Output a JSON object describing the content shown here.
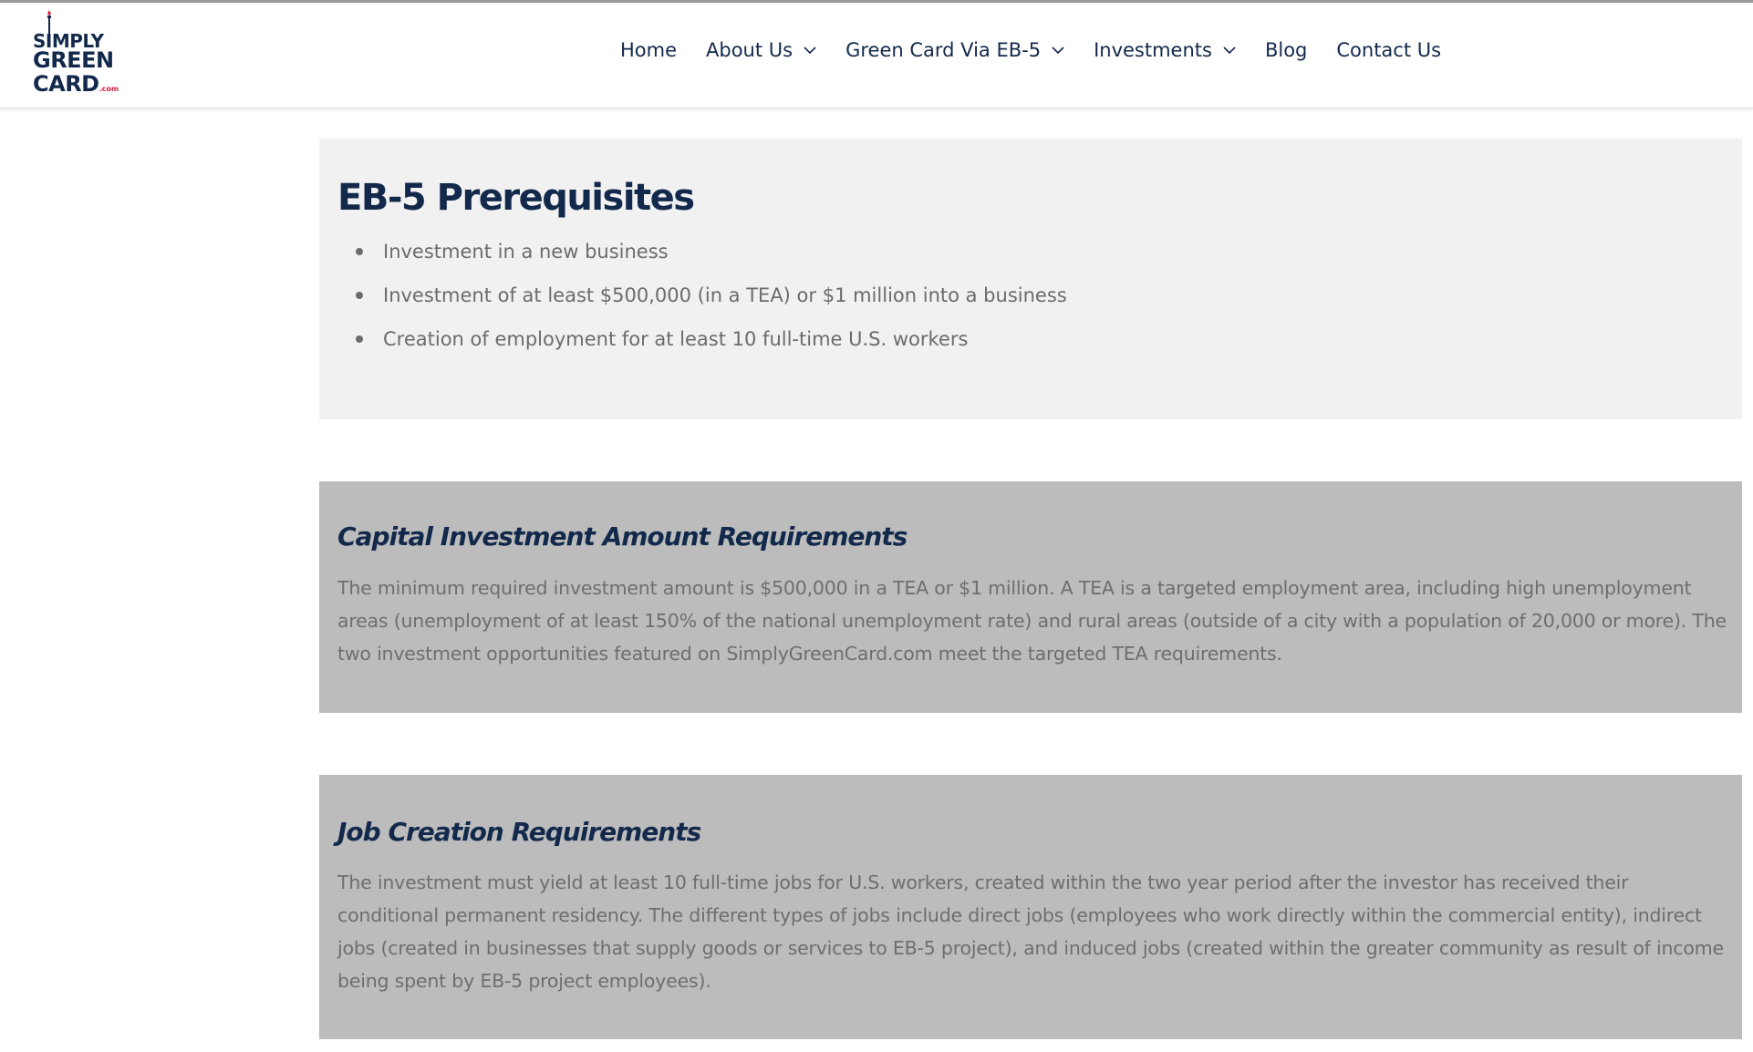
{
  "header": {
    "logo": {
      "line1": "SIMPLY",
      "line2": "GREEN",
      "line3": "CARD",
      "suffix": ".com"
    },
    "nav": [
      {
        "label": "Home",
        "has_dropdown": false
      },
      {
        "label": "About Us",
        "has_dropdown": true
      },
      {
        "label": "Green Card Via EB-5",
        "has_dropdown": true
      },
      {
        "label": "Investments",
        "has_dropdown": true
      },
      {
        "label": "Blog",
        "has_dropdown": false
      },
      {
        "label": "Contact Us",
        "has_dropdown": false
      }
    ]
  },
  "prerequisites": {
    "title": "EB-5 Prerequisites",
    "items": [
      "Investment in a new business",
      "Investment of at least $500,000 (in a TEA) or $1 million into a business",
      "Creation of employment for at least 10 full-time U.S. workers"
    ]
  },
  "capital": {
    "title": "Capital Investment Amount Requirements",
    "body": "The minimum required investment amount is $500,000 in a TEA or $1 million. A TEA is a targeted employment area, including high unemployment areas (unemployment of at least 150% of the national unemployment rate) and rural areas (outside of a city with a population of 20,000 or more). The two investment opportunities featured on SimplyGreenCard.com meet the targeted TEA requirements."
  },
  "jobs": {
    "title": "Job Creation Requirements",
    "body": "The investment must yield at least 10 full-time jobs for U.S. workers, created within the two year period after the investor has received their conditional permanent residency. The different types of jobs include direct jobs (employees who work directly within the commercial entity), indirect jobs (created in businesses that supply goods or services to EB-5 project), and induced jobs (created within the greater community as result of income being spent by EB-5 project employees)."
  },
  "colors": {
    "brand_navy": "#13294b",
    "brand_red": "#d6213a",
    "panel_light": "#f1f1f1",
    "panel_gray": "#bcbcbc",
    "body_text": "#6e6e6e"
  }
}
